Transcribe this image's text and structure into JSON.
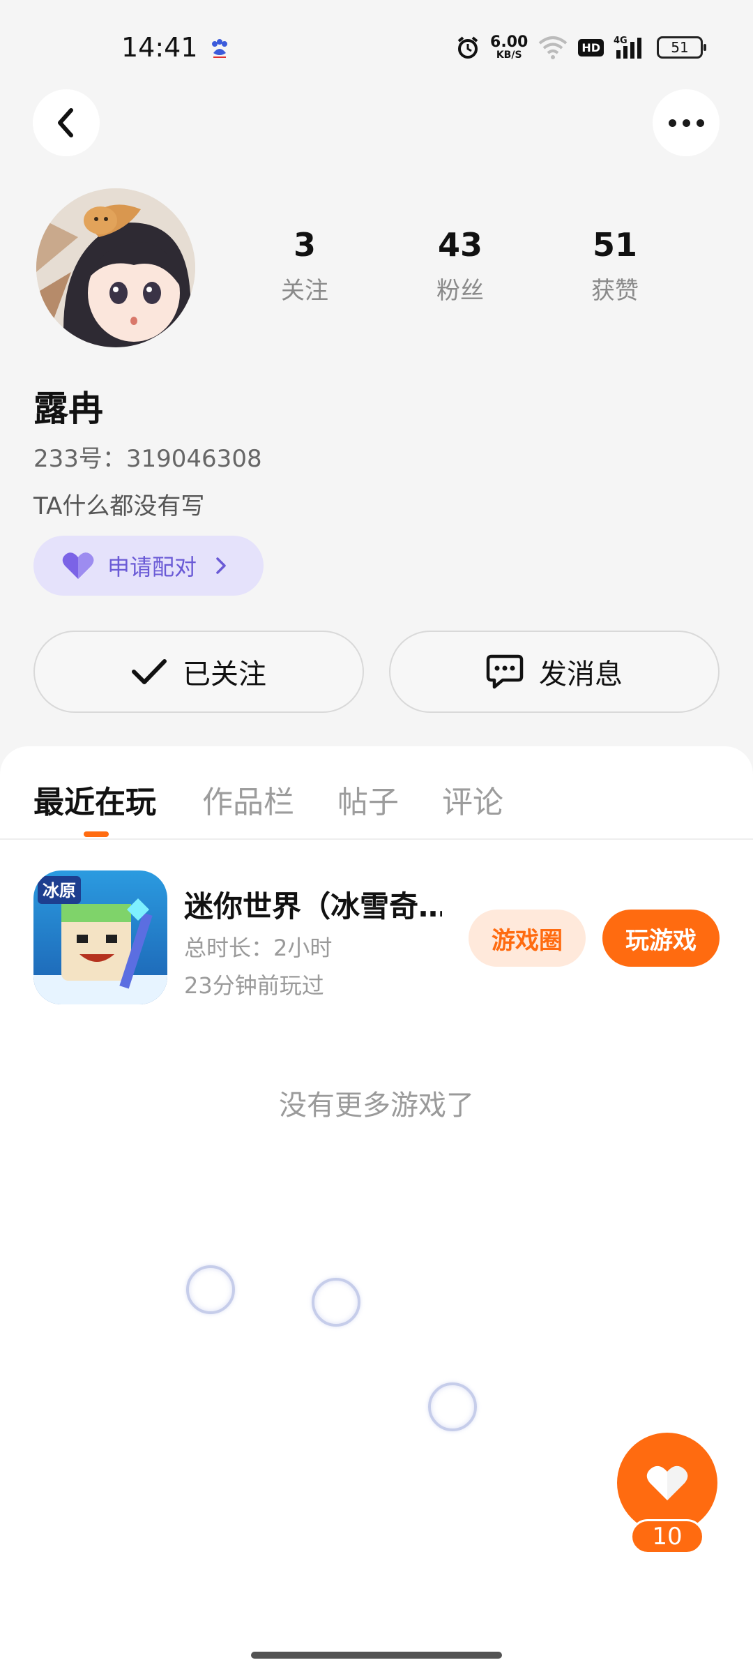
{
  "status_bar": {
    "time": "14:41",
    "net_speed_value": "6.00",
    "net_speed_unit": "KB/S",
    "hd": "HD",
    "network": "4G",
    "battery": "51"
  },
  "profile": {
    "nickname": "露冉",
    "uid": "233号：319046308",
    "bio": "TA什么都没有写",
    "stats": [
      {
        "value": "3",
        "label": "关注"
      },
      {
        "value": "43",
        "label": "粉丝"
      },
      {
        "value": "51",
        "label": "获赞"
      }
    ],
    "pair_label": "申请配对",
    "follow_label": "已关注",
    "message_label": "发消息"
  },
  "tabs": [
    {
      "label": "最近在玩",
      "active": true
    },
    {
      "label": "作品栏",
      "active": false
    },
    {
      "label": "帖子",
      "active": false
    },
    {
      "label": "评论",
      "active": false
    }
  ],
  "games": [
    {
      "title": "迷你世界（冰雪奇…",
      "duration": "总时长：2小时",
      "last_played": "23分钟前玩过",
      "icon_badge": "冰原",
      "circle_label": "游戏圈",
      "play_label": "玩游戏"
    }
  ],
  "no_more": "没有更多游戏了",
  "like": {
    "count": "10"
  },
  "colors": {
    "accent": "#ff6b10",
    "pair_bg": "#e5e2fb",
    "pair_text": "#6a5ad6"
  }
}
